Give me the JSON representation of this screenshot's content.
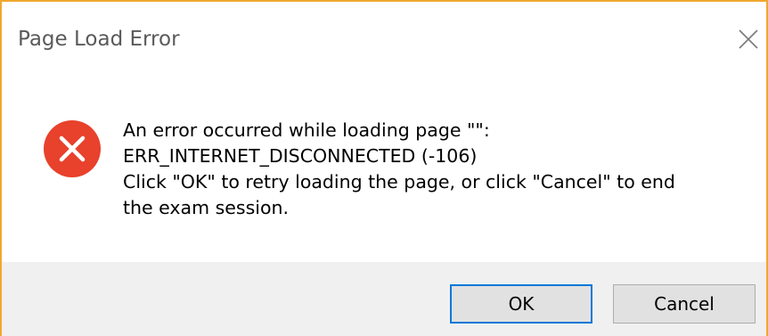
{
  "window": {
    "title": "Page Load Error",
    "close_icon": "close-icon"
  },
  "content": {
    "icon": "error-icon",
    "icon_color": "#e8412c",
    "lines": [
      "An error occurred while loading page \"\":",
      "ERR_INTERNET_DISCONNECTED (-106)",
      "Click \"OK\" to retry loading the page, or click \"Cancel\" to end",
      "the exam session."
    ]
  },
  "buttons": {
    "ok_label": "OK",
    "cancel_label": "Cancel"
  },
  "colors": {
    "window_border": "#f0a830",
    "default_button_border": "#0078d7",
    "footer_background": "#f0f0f0"
  }
}
